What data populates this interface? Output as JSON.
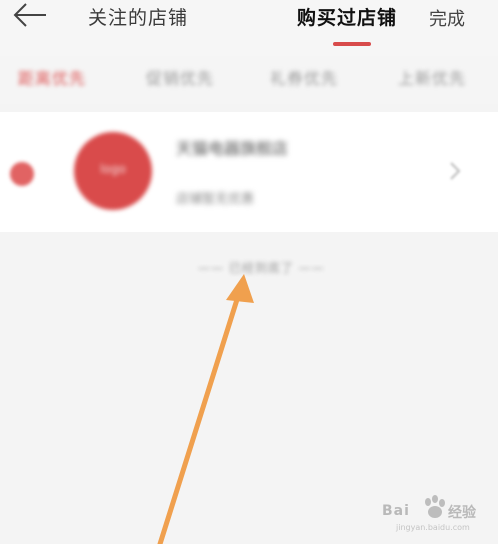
{
  "header": {
    "tab_followed": "关注的店铺",
    "tab_purchased": "购买过店铺",
    "done_label": "完成",
    "accent_color": "#d84b4b"
  },
  "filters": {
    "items": [
      "距离优先",
      "促销优先",
      "礼券优先",
      "上新优先"
    ],
    "active_index": 0
  },
  "shop": {
    "avatar_label": "logo",
    "name": "天猫电器旗舰店",
    "subtitle": "店铺暂无优惠"
  },
  "list_end": "—— 已经到底了 ——",
  "watermark": {
    "brand_left": "Bai",
    "brand_right": "经验",
    "url": "jingyan.baidu.com"
  }
}
